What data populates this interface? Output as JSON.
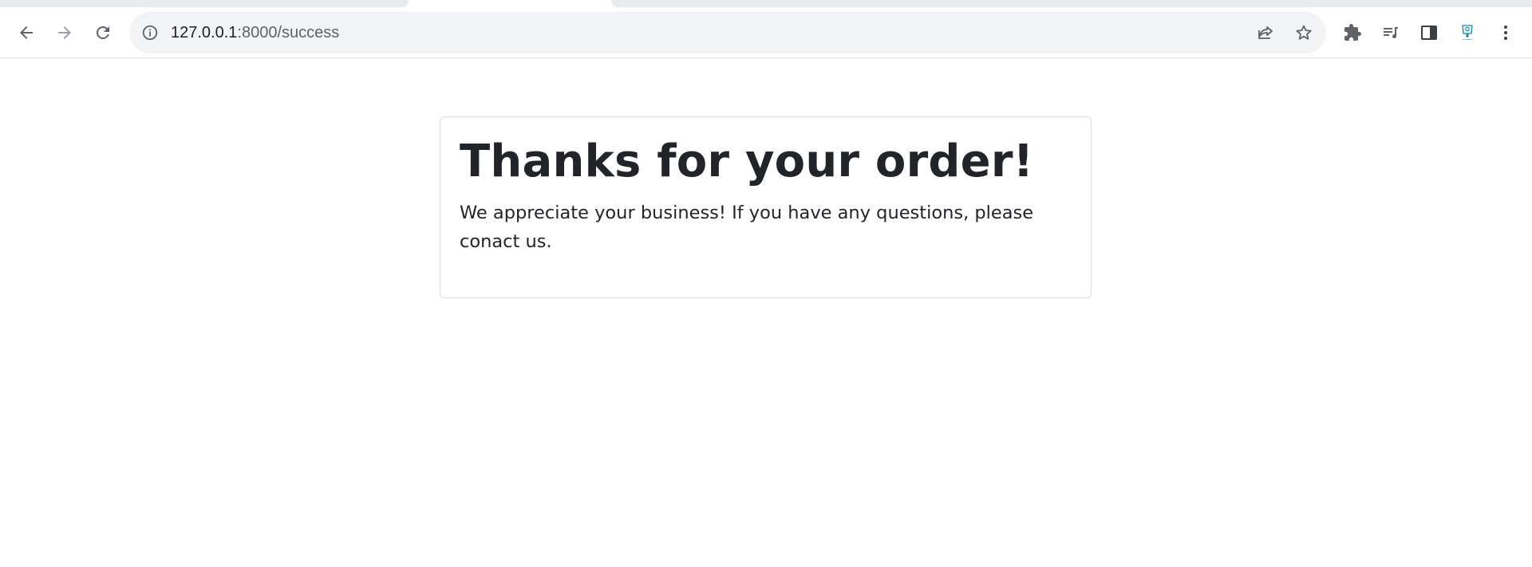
{
  "browser": {
    "address": {
      "host": "127.0.0.1",
      "path": ":8000/success"
    },
    "icons": {
      "back": "arrow-left-icon",
      "forward": "arrow-right-icon",
      "reload": "reload-icon",
      "info": "info-icon",
      "share": "share-icon",
      "bookmark": "star-icon",
      "extensions": "puzzle-icon",
      "media": "playlist-icon",
      "side_panel": "side-panel-icon",
      "profile": "profile-avatar-icon",
      "menu": "kebab-menu-icon"
    },
    "colors": {
      "toolbar_icon": "#5f6368",
      "disabled_icon": "#9aa0a6",
      "omnibox_bg": "#f1f3f4",
      "tab_bg": "#e8eaed"
    }
  },
  "page": {
    "heading": "Thanks for your order!",
    "message": "We appreciate your business! If you have any questions, please conact us.",
    "colors": {
      "text": "#212529",
      "card_border": "#dcdcdc"
    }
  }
}
